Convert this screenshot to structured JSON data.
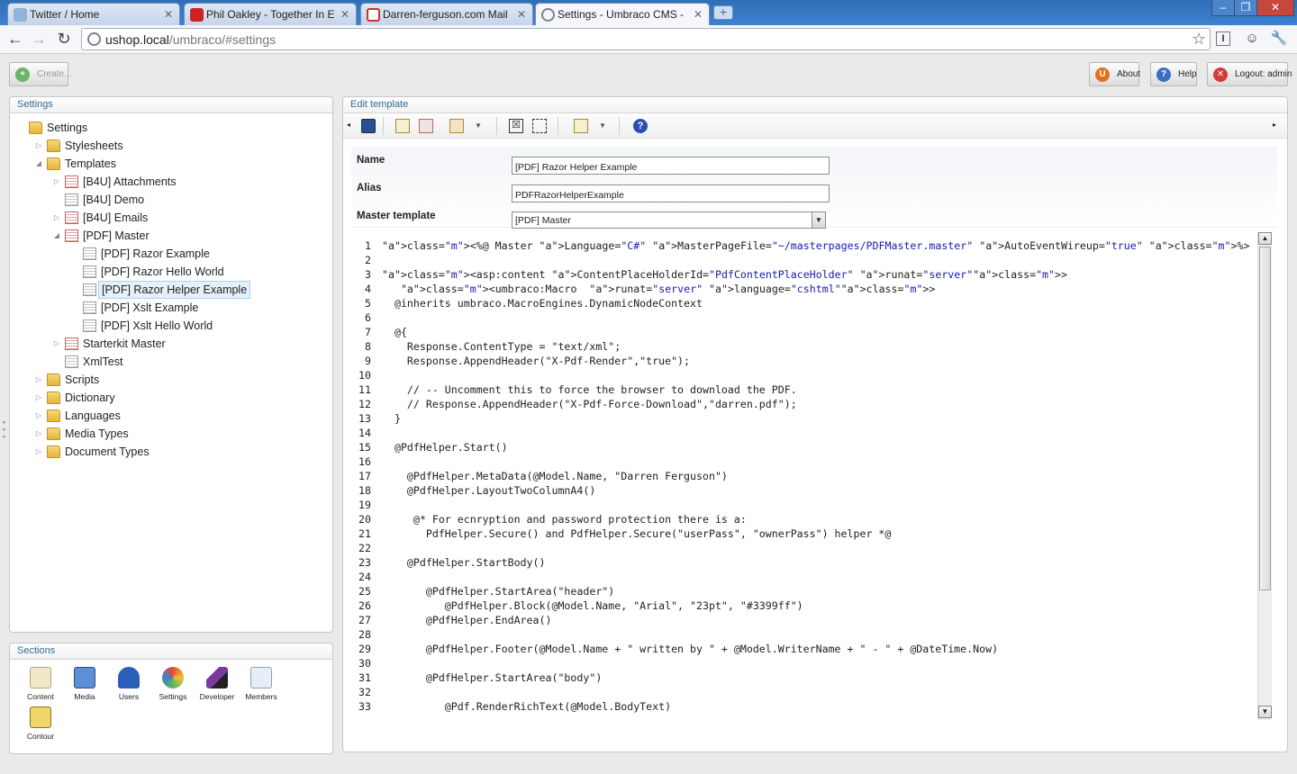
{
  "browser": {
    "tabs": [
      {
        "title": "Twitter / Home",
        "favicon_color": "#8fb3d9"
      },
      {
        "title": "Phil Oakley - Together In Elect",
        "favicon_color": "#cc2222"
      },
      {
        "title": "Darren-ferguson.com Mail - Inb",
        "favicon_color": "#d0312d"
      },
      {
        "title": "Settings - Umbraco CMS - usho",
        "favicon_color": "#7a8390"
      }
    ],
    "new_tab_label": "+",
    "url_host": "ushop.local",
    "url_rest": "/umbraco/#settings",
    "window_controls": {
      "minimize": "–",
      "maximize": "❐",
      "close": "✕"
    }
  },
  "topbar": {
    "create_label": "Create...",
    "about_label": "About",
    "help_label": "Help",
    "logout_label": "Logout: admin"
  },
  "settings_panel": {
    "title": "Settings",
    "tree": [
      {
        "label": "Settings",
        "depth": 0,
        "icon": "folder-icon",
        "arrow": ""
      },
      {
        "label": "Stylesheets",
        "depth": 1,
        "icon": "folder-icon",
        "arrow": "▷"
      },
      {
        "label": "Templates",
        "depth": 1,
        "icon": "folder-icon",
        "arrow": "◢"
      },
      {
        "label": "[B4U] Attachments",
        "depth": 2,
        "icon": "master-template-icon",
        "arrow": "▷"
      },
      {
        "label": "[B4U] Demo",
        "depth": 2,
        "icon": "template-icon",
        "arrow": ""
      },
      {
        "label": "[B4U] Emails",
        "depth": 2,
        "icon": "master-template-icon",
        "arrow": "▷"
      },
      {
        "label": "[PDF] Master",
        "depth": 2,
        "icon": "master-template-icon",
        "arrow": "◢"
      },
      {
        "label": "[PDF] Razor Example",
        "depth": 3,
        "icon": "template-icon",
        "arrow": ""
      },
      {
        "label": "[PDF] Razor Hello World",
        "depth": 3,
        "icon": "template-icon",
        "arrow": ""
      },
      {
        "label": "[PDF] Razor Helper Example",
        "depth": 3,
        "icon": "template-icon",
        "arrow": "",
        "selected": true
      },
      {
        "label": "[PDF] Xslt Example",
        "depth": 3,
        "icon": "template-icon",
        "arrow": ""
      },
      {
        "label": "[PDF] Xslt Hello World",
        "depth": 3,
        "icon": "template-icon",
        "arrow": ""
      },
      {
        "label": "Starterkit Master",
        "depth": 2,
        "icon": "master-template-icon",
        "arrow": "▷"
      },
      {
        "label": "XmlTest",
        "depth": 2,
        "icon": "template-icon",
        "arrow": ""
      },
      {
        "label": "Scripts",
        "depth": 1,
        "icon": "folder-icon",
        "arrow": "▷"
      },
      {
        "label": "Dictionary",
        "depth": 1,
        "icon": "folder-icon",
        "arrow": "▷"
      },
      {
        "label": "Languages",
        "depth": 1,
        "icon": "folder-icon",
        "arrow": "▷"
      },
      {
        "label": "Media Types",
        "depth": 1,
        "icon": "folder-icon",
        "arrow": "▷"
      },
      {
        "label": "Document Types",
        "depth": 1,
        "icon": "folder-icon",
        "arrow": "▷"
      }
    ]
  },
  "sections_panel": {
    "title": "Sections",
    "items": [
      {
        "label": "Content",
        "icon": "content-icon",
        "color": "#f0e6c8"
      },
      {
        "label": "Media",
        "icon": "media-icon",
        "color": "#5b8fd6"
      },
      {
        "label": "Users",
        "icon": "users-icon",
        "color": "#2a5fb8"
      },
      {
        "label": "Settings",
        "icon": "settings-icon",
        "color": "#e8a030"
      },
      {
        "label": "Developer",
        "icon": "developer-icon",
        "color": "#7a3aa0"
      },
      {
        "label": "Members",
        "icon": "members-icon",
        "color": "#a8bcd8"
      },
      {
        "label": "Contour",
        "icon": "contour-icon",
        "color": "#f2d56a"
      }
    ]
  },
  "edit_panel": {
    "title": "Edit template",
    "name_label": "Name",
    "name_value": "[PDF] Razor Helper Example",
    "alias_label": "Alias",
    "alias_value": "PDFRazorHelperExample",
    "master_label": "Master template",
    "master_value": "[PDF] Master",
    "help_glyph": "?"
  },
  "code_lines": [
    "<%@ Master Language=\"C#\" MasterPageFile=\"~/masterpages/PDFMaster.master\" AutoEventWireup=\"true\" %>",
    "",
    "<asp:content ContentPlaceHolderId=\"PdfContentPlaceHolder\" runat=\"server\">",
    "   <umbraco:Macro  runat=\"server\" language=\"cshtml\">",
    "  @inherits umbraco.MacroEngines.DynamicNodeContext",
    "",
    "  @{",
    "    Response.ContentType = \"text/xml\";",
    "    Response.AppendHeader(\"X-Pdf-Render\",\"true\");",
    "",
    "    // -- Uncomment this to force the browser to download the PDF.",
    "    // Response.AppendHeader(\"X-Pdf-Force-Download\",\"darren.pdf\");",
    "  }",
    "",
    "  @PdfHelper.Start()",
    "",
    "    @PdfHelper.MetaData(@Model.Name, \"Darren Ferguson\")",
    "    @PdfHelper.LayoutTwoColumnA4()",
    "",
    "     @* For ecnryption and password protection there is a:",
    "       PdfHelper.Secure() and PdfHelper.Secure(\"userPass\", \"ownerPass\") helper *@",
    "",
    "    @PdfHelper.StartBody()",
    "",
    "       @PdfHelper.StartArea(\"header\")",
    "          @PdfHelper.Block(@Model.Name, \"Arial\", \"23pt\", \"#3399ff\")",
    "       @PdfHelper.EndArea()",
    "",
    "       @PdfHelper.Footer(@Model.Name + \" written by \" + @Model.WriterName + \" - \" + @DateTime.Now)",
    "",
    "       @PdfHelper.StartArea(\"body\")",
    "",
    "          @Pdf.RenderRichText(@Model.BodyText)"
  ]
}
